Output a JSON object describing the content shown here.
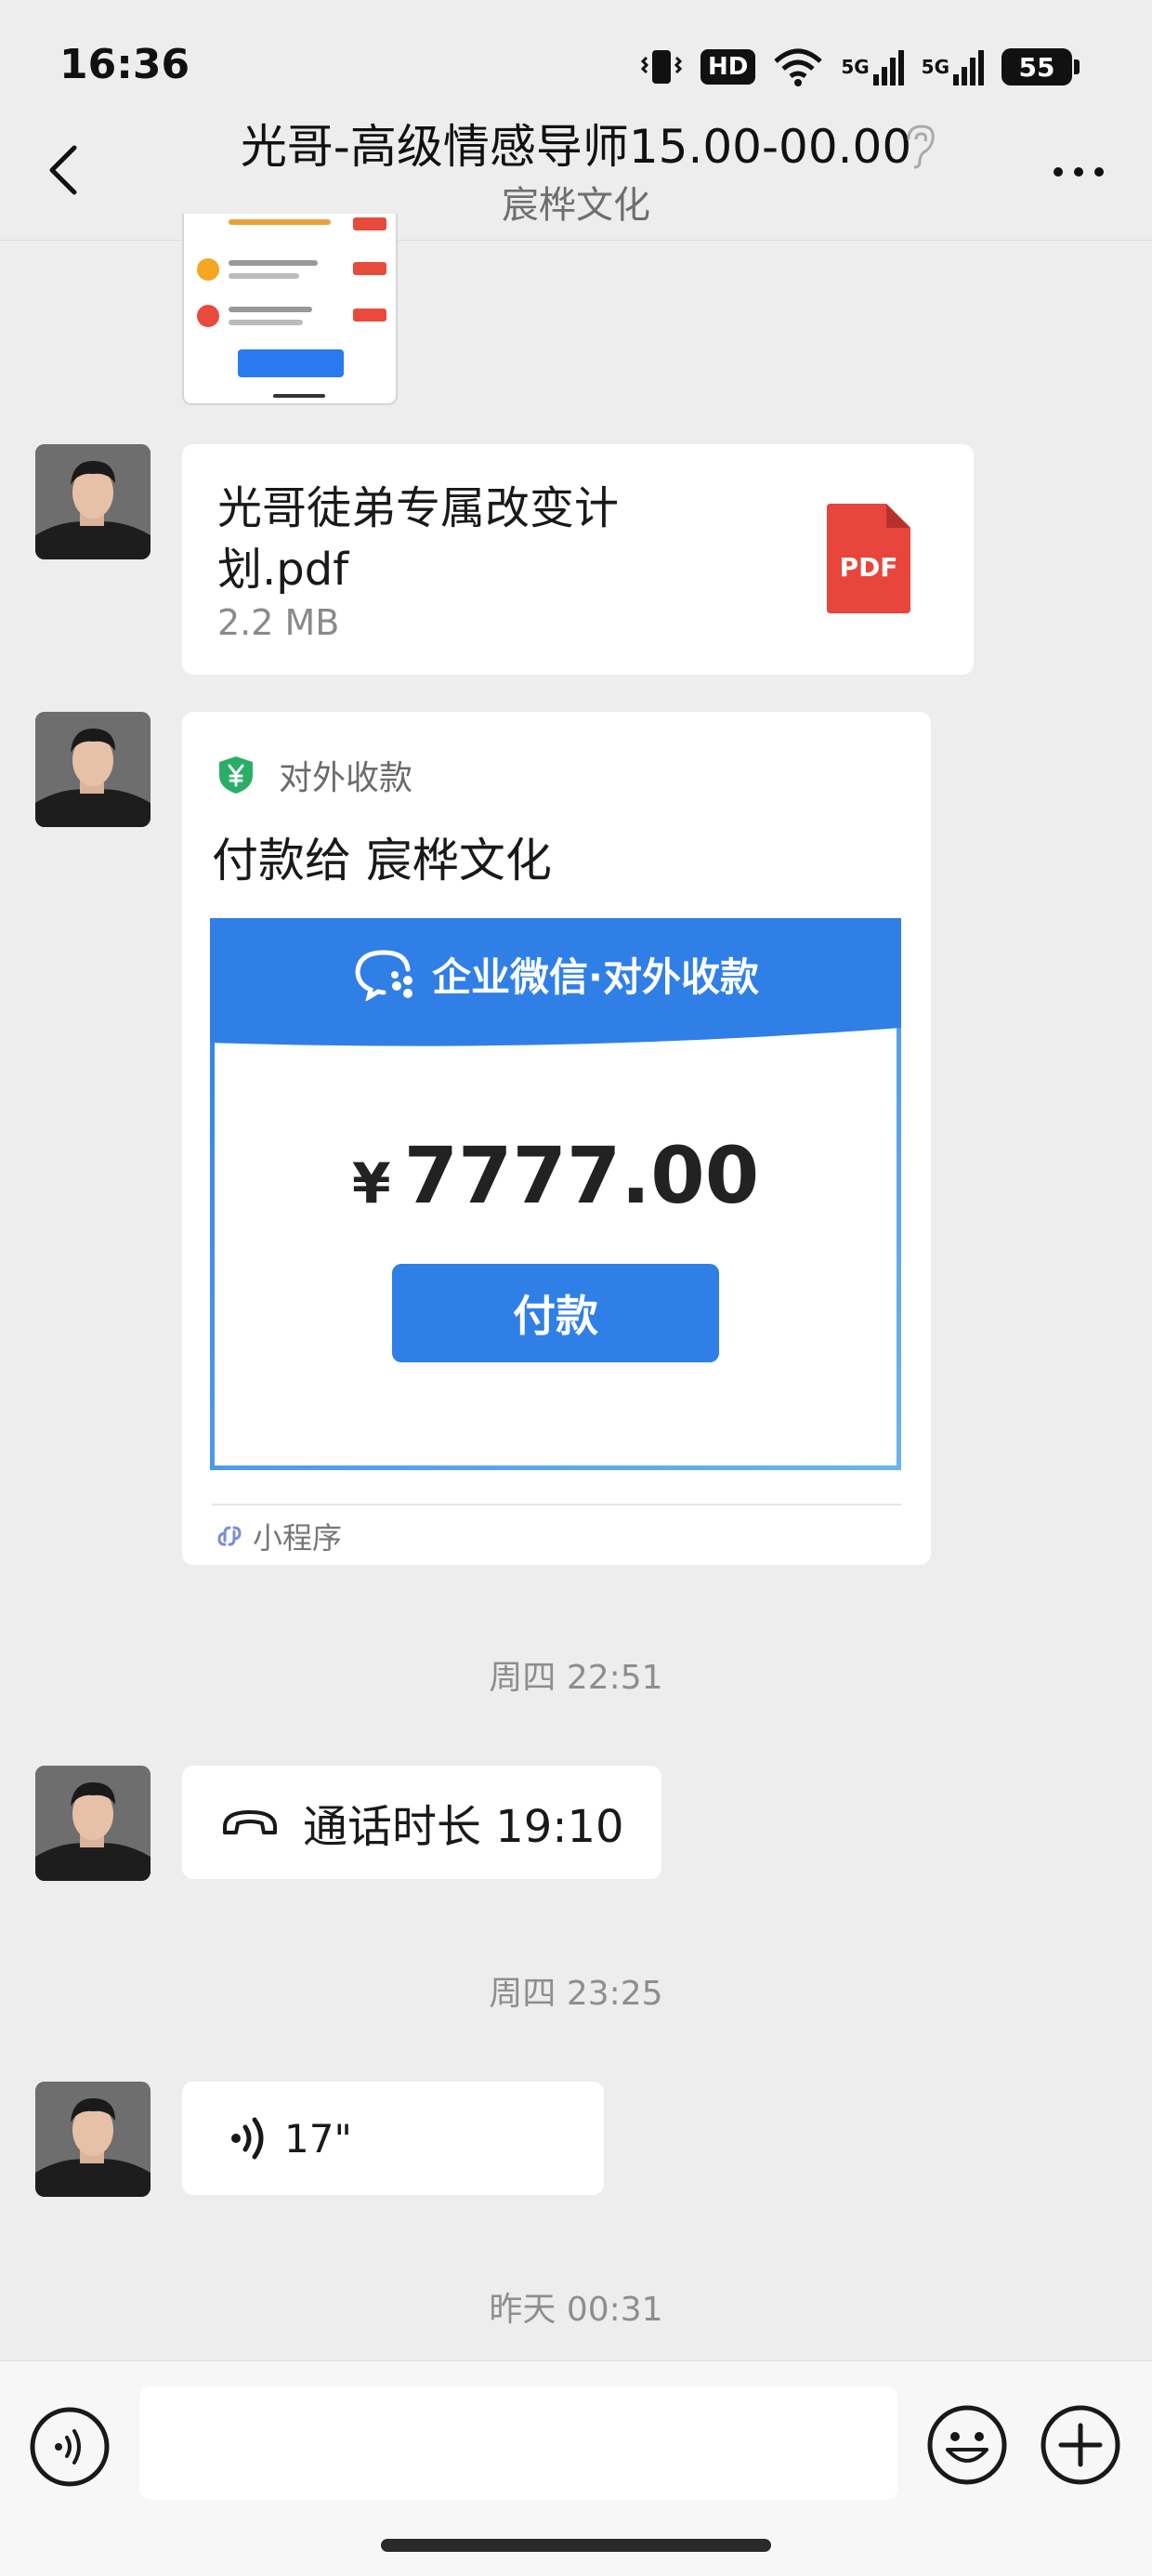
{
  "status_bar": {
    "time": "16:36",
    "hd_label": "HD",
    "signal_label_1": "5G",
    "signal_label_2": "5G",
    "battery": "55"
  },
  "nav": {
    "title": "光哥-高级情感导师15.00-00.00",
    "subtitle": "宸桦文化"
  },
  "messages": {
    "file": {
      "name": "光哥徒弟专属改变计划.pdf",
      "size": "2.2 MB",
      "badge": "PDF"
    },
    "payment": {
      "header_label": "对外收款",
      "title": "付款给 宸桦文化",
      "banner_text": "企业微信·对外收款",
      "currency": "¥",
      "amount": "7777.00",
      "button_label": "付款",
      "footer_label": "小程序"
    },
    "timestamp_1": "周四 22:51",
    "call": {
      "text": "通话时长 19:10"
    },
    "timestamp_2": "周四 23:25",
    "voice": {
      "duration": "17\""
    },
    "timestamp_3": "昨天 00:31"
  },
  "colors": {
    "background": "#ededed",
    "bubble": "#ffffff",
    "accent_blue": "#2f7fe7",
    "pdf_red": "#e8453c",
    "pay_green": "#2aae67"
  },
  "icons": {
    "back": "chevron-left-icon",
    "ear": "ear-icon",
    "more": "more-dots-icon",
    "pdf": "pdf-file-icon",
    "payment": "yuan-shield-icon",
    "mini_program": "link-icon",
    "call": "phone-hangup-icon",
    "voice": "voice-wave-icon",
    "voice_toggle": "voice-input-icon",
    "emoji": "emoji-icon",
    "plus": "plus-icon"
  }
}
